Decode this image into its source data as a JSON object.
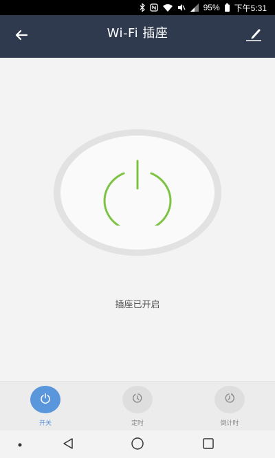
{
  "status_bar": {
    "battery": "95%",
    "time": "下午5:31"
  },
  "header": {
    "title": "Wi-Fi 插座",
    "back_icon": "arrow-left-icon",
    "edit_icon": "edit-icon"
  },
  "main": {
    "status_text": "插座已开启",
    "power_icon": "power-icon",
    "accent_color": "#7dc242"
  },
  "actions": [
    {
      "label": "开关",
      "icon": "power-icon",
      "active": true
    },
    {
      "label": "定时",
      "icon": "timer-icon",
      "active": false
    },
    {
      "label": "倒计时",
      "icon": "countdown-icon",
      "active": false
    }
  ],
  "colors": {
    "header_bg": "#2f3a4f",
    "active_blue": "#5a96db",
    "power_green": "#7dc242"
  }
}
